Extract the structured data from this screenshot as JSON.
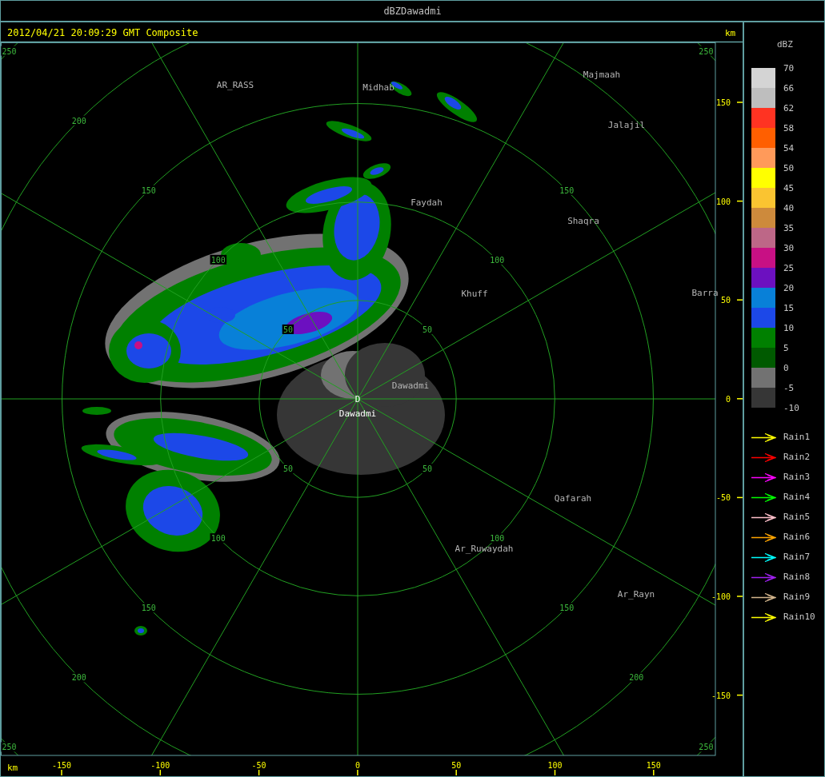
{
  "window": {
    "title": "dBZDawadmi"
  },
  "header": {
    "timestamp": "2012/04/21 20:09:29 GMT Composite",
    "unit": "km"
  },
  "radar_map": {
    "ring_labels": [
      "250",
      "250",
      "250",
      "250",
      "200",
      "200",
      "200",
      "150",
      "150",
      "150",
      "150",
      "100",
      "100",
      "100",
      "100",
      "50",
      "50",
      "50",
      "50"
    ],
    "places": [
      "AR_RASS",
      "Midhab",
      "Majmaah",
      "Jalajil",
      "Faydah",
      "Shaqra",
      "Khuff",
      "Barra",
      "Dawadmi",
      "Qafarah",
      "Ar_Ruwaydah",
      "Ar_Rayn"
    ],
    "site": {
      "marker": "D",
      "name": "Dawadmi"
    }
  },
  "y_axis": {
    "ticks": [
      "150",
      "100",
      "50",
      "0",
      "-50",
      "-100",
      "-150"
    ]
  },
  "x_axis": {
    "unit": "km",
    "ticks": [
      "-150",
      "-100",
      "-50",
      "0",
      "50",
      "100",
      "150"
    ]
  },
  "legend": {
    "title": "dBZ",
    "bottom_label": "-10",
    "scale": [
      {
        "label": "70",
        "color": "#d4d4d4"
      },
      {
        "label": "66",
        "color": "#bebebe"
      },
      {
        "label": "62",
        "color": "#ff3322"
      },
      {
        "label": "58",
        "color": "#ff5f00"
      },
      {
        "label": "54",
        "color": "#ff9a5a"
      },
      {
        "label": "50",
        "color": "#ffff00"
      },
      {
        "label": "45",
        "color": "#fac431"
      },
      {
        "label": "40",
        "color": "#cd8a3c"
      },
      {
        "label": "35",
        "color": "#bd6787"
      },
      {
        "label": "30",
        "color": "#c81084"
      },
      {
        "label": "25",
        "color": "#6c10c0"
      },
      {
        "label": "20",
        "color": "#0880d8"
      },
      {
        "label": "15",
        "color": "#1c48e8"
      },
      {
        "label": "10",
        "color": "#008000"
      },
      {
        "label": "5",
        "color": "#005a00"
      },
      {
        "label": "0",
        "color": "#727272"
      },
      {
        "label": "-5",
        "color": "#363636"
      }
    ],
    "tracks": [
      {
        "label": "Rain1",
        "color": "#ffff00"
      },
      {
        "label": "Rain2",
        "color": "#ff0000"
      },
      {
        "label": "Rain3",
        "color": "#ff00ff"
      },
      {
        "label": "Rain4",
        "color": "#00ff00"
      },
      {
        "label": "Rain5",
        "color": "#ffc0cb"
      },
      {
        "label": "Rain6",
        "color": "#ffa500"
      },
      {
        "label": "Rain7",
        "color": "#00ffff"
      },
      {
        "label": "Rain8",
        "color": "#a020f0"
      },
      {
        "label": "Rain9",
        "color": "#d2b48c"
      },
      {
        "label": "Rain10",
        "color": "#ffff00"
      }
    ]
  }
}
